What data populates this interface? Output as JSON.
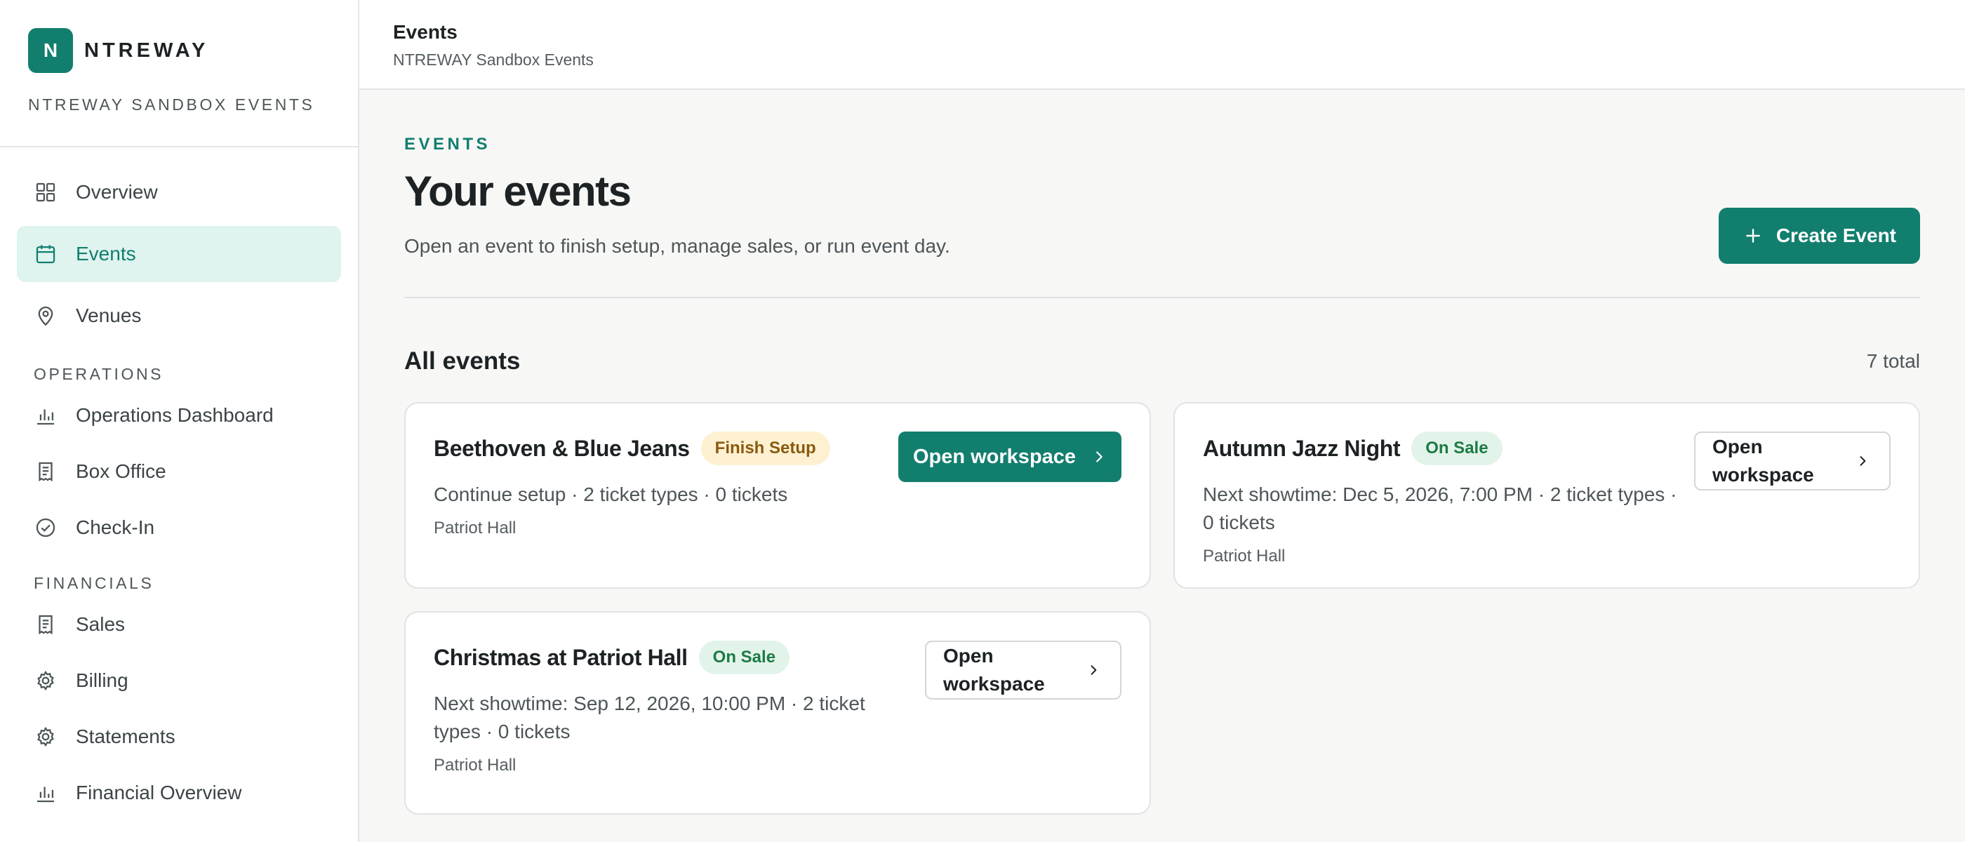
{
  "brand": {
    "logo_letter": "N",
    "name": "NTREWAY",
    "org": "NTREWAY SANDBOX EVENTS"
  },
  "nav": {
    "main": [
      {
        "label": "Overview",
        "icon": "grid-icon",
        "active": false
      },
      {
        "label": "Events",
        "icon": "calendar-icon",
        "active": true
      },
      {
        "label": "Venues",
        "icon": "map-pin-icon",
        "active": false
      }
    ],
    "operations_label": "OPERATIONS",
    "operations": [
      {
        "label": "Operations Dashboard",
        "icon": "bar-chart-icon"
      },
      {
        "label": "Box Office",
        "icon": "receipt-icon"
      },
      {
        "label": "Check-In",
        "icon": "check-circle-icon"
      }
    ],
    "financials_label": "FINANCIALS",
    "financials": [
      {
        "label": "Sales",
        "icon": "receipt-icon"
      },
      {
        "label": "Billing",
        "icon": "gear-icon"
      },
      {
        "label": "Statements",
        "icon": "gear-icon"
      },
      {
        "label": "Financial Overview",
        "icon": "bar-chart-icon"
      }
    ]
  },
  "topbar": {
    "title": "Events",
    "subtitle": "NTREWAY Sandbox Events"
  },
  "header": {
    "eyebrow": "EVENTS",
    "title": "Your events",
    "description": "Open an event to finish setup, manage sales, or run event day.",
    "create_label": "Create Event"
  },
  "list": {
    "title": "All events",
    "count": "7 total",
    "events": [
      {
        "title": "Beethoven & Blue Jeans",
        "status": "Finish Setup",
        "meta": "Continue setup · 2 ticket types · 0 tickets",
        "venue": "Patriot Hall",
        "action": "Open workspace"
      },
      {
        "title": "Autumn Jazz Night",
        "status": "On Sale",
        "meta": "Next showtime: Dec 5, 2026, 7:00 PM · 2 ticket types · 0 tickets",
        "venue": "Patriot Hall",
        "action": "Open workspace"
      },
      {
        "title": "Christmas at Patriot Hall",
        "status": "On Sale",
        "meta": "Next showtime: Sep 12, 2026, 10:00 PM · 2 ticket types · 0 tickets",
        "venue": "Patriot Hall",
        "action": "Open workspace"
      }
    ]
  },
  "colors": {
    "accent": "#127e6e",
    "active_bg": "#dff3ef",
    "setup_badge_bg": "#fdf1d2",
    "sale_badge_bg": "#e2f4ea"
  }
}
